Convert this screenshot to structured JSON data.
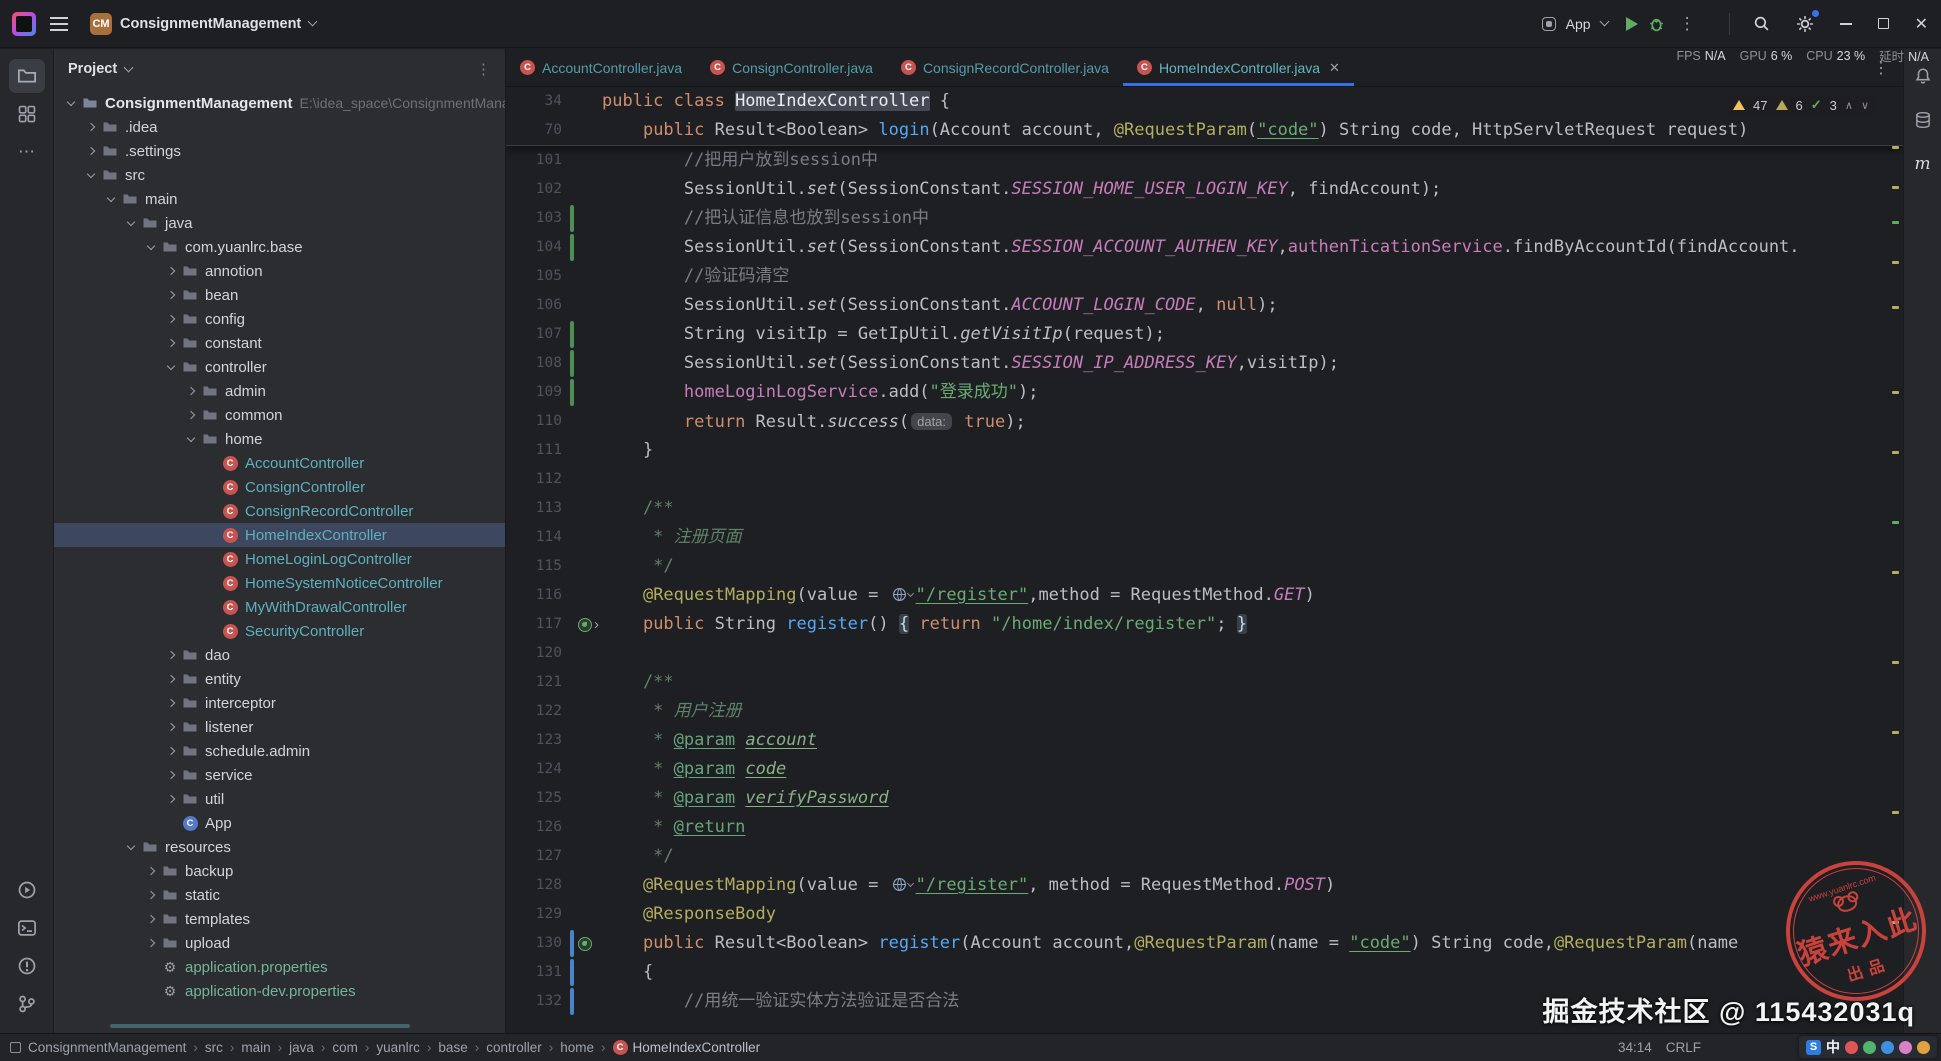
{
  "titlebar": {
    "project_badge": "CM",
    "project_name": "ConsignmentManagement",
    "run_config_label": "App",
    "perf": [
      [
        "FPS",
        "N/A"
      ],
      [
        "GPU",
        "6 %"
      ],
      [
        "CPU",
        "23 %"
      ],
      [
        "延时",
        "N/A"
      ]
    ]
  },
  "stripes": {
    "left_top": [
      "project",
      "structure",
      "more"
    ],
    "left_bottom": [
      "services",
      "terminal",
      "problems",
      "version-control"
    ],
    "right": [
      "notifications",
      "database",
      "maven"
    ]
  },
  "project_panel": {
    "title": "Project",
    "tree": [
      {
        "l": "ConsignmentManagement",
        "lv": 0,
        "ch": "o",
        "ic": "root",
        "bold": true,
        "ann": "E:\\idea_space\\ConsignmentManagem"
      },
      {
        "l": ".idea",
        "lv": 1,
        "ch": "c",
        "ic": "folder"
      },
      {
        "l": ".settings",
        "lv": 1,
        "ch": "c",
        "ic": "folder"
      },
      {
        "l": "src",
        "lv": 1,
        "ch": "o",
        "ic": "folder"
      },
      {
        "l": "main",
        "lv": 2,
        "ch": "o",
        "ic": "folder"
      },
      {
        "l": "java",
        "lv": 3,
        "ch": "o",
        "ic": "folder"
      },
      {
        "l": "com.yuanlrc.base",
        "lv": 4,
        "ch": "o",
        "ic": "folder"
      },
      {
        "l": "annotion",
        "lv": 5,
        "ch": "c",
        "ic": "folder"
      },
      {
        "l": "bean",
        "lv": 5,
        "ch": "c",
        "ic": "folder"
      },
      {
        "l": "config",
        "lv": 5,
        "ch": "c",
        "ic": "folder"
      },
      {
        "l": "constant",
        "lv": 5,
        "ch": "c",
        "ic": "folder"
      },
      {
        "l": "controller",
        "lv": 5,
        "ch": "o",
        "ic": "folder"
      },
      {
        "l": "admin",
        "lv": 6,
        "ch": "c",
        "ic": "folder"
      },
      {
        "l": "common",
        "lv": 6,
        "ch": "c",
        "ic": "folder"
      },
      {
        "l": "home",
        "lv": 6,
        "ch": "o",
        "ic": "folder"
      },
      {
        "l": "AccountController",
        "lv": 7,
        "ic": "class",
        "clr": "cyan"
      },
      {
        "l": "ConsignController",
        "lv": 7,
        "ic": "class",
        "clr": "cyan"
      },
      {
        "l": "ConsignRecordController",
        "lv": 7,
        "ic": "class",
        "clr": "cyan"
      },
      {
        "l": "HomeIndexController",
        "lv": 7,
        "ic": "class",
        "clr": "cyan",
        "sel": true
      },
      {
        "l": "HomeLoginLogController",
        "lv": 7,
        "ic": "class",
        "clr": "cyan"
      },
      {
        "l": "HomeSystemNoticeController",
        "lv": 7,
        "ic": "class",
        "clr": "cyan"
      },
      {
        "l": "MyWithDrawalController",
        "lv": 7,
        "ic": "class",
        "clr": "cyan"
      },
      {
        "l": "SecurityController",
        "lv": 7,
        "ic": "class",
        "clr": "cyan"
      },
      {
        "l": "dao",
        "lv": 5,
        "ch": "c",
        "ic": "folder"
      },
      {
        "l": "entity",
        "lv": 5,
        "ch": "c",
        "ic": "folder"
      },
      {
        "l": "interceptor",
        "lv": 5,
        "ch": "c",
        "ic": "folder"
      },
      {
        "l": "listener",
        "lv": 5,
        "ch": "c",
        "ic": "folder"
      },
      {
        "l": "schedule.admin",
        "lv": 5,
        "ch": "c",
        "ic": "folder"
      },
      {
        "l": "service",
        "lv": 5,
        "ch": "c",
        "ic": "folder"
      },
      {
        "l": "util",
        "lv": 5,
        "ch": "c",
        "ic": "folder"
      },
      {
        "l": "App",
        "lv": 5,
        "ic": "classb"
      },
      {
        "l": "resources",
        "lv": 3,
        "ch": "o",
        "ic": "folder"
      },
      {
        "l": "backup",
        "lv": 4,
        "ch": "c",
        "ic": "folder"
      },
      {
        "l": "static",
        "lv": 4,
        "ch": "c",
        "ic": "folder"
      },
      {
        "l": "templates",
        "lv": 4,
        "ch": "c",
        "ic": "folder"
      },
      {
        "l": "upload",
        "lv": 4,
        "ch": "c",
        "ic": "folder"
      },
      {
        "l": "application.properties",
        "lv": 4,
        "ic": "props",
        "clr": "green"
      },
      {
        "l": "application-dev.properties",
        "lv": 4,
        "ic": "props",
        "clr": "green"
      }
    ]
  },
  "tabs": [
    {
      "label": "AccountController.java",
      "active": false
    },
    {
      "label": "ConsignController.java",
      "active": false
    },
    {
      "label": "ConsignRecordController.java",
      "active": false
    },
    {
      "label": "HomeIndexController.java",
      "active": true
    }
  ],
  "editor": {
    "inspections": {
      "warnings": "47",
      "weak": "6",
      "passed": "3"
    },
    "sticky_lines": [
      {
        "n": "34",
        "segs": [
          [
            "public class ",
            "kw"
          ],
          [
            "HomeIndexController",
            "hl"
          ],
          [
            " {",
            "pln"
          ]
        ]
      },
      {
        "n": "70",
        "segs": [
          [
            "    ",
            "pln"
          ],
          [
            "public ",
            "kw"
          ],
          [
            "Result<Boolean> ",
            "pln"
          ],
          [
            "login",
            "mdecl"
          ],
          [
            "(Account account, ",
            "pln"
          ],
          [
            "@RequestParam",
            "ann"
          ],
          [
            "(",
            "pln"
          ],
          [
            "\"code\"",
            "strU"
          ],
          [
            ") String code, HttpServletRequest request)",
            "pln"
          ]
        ]
      }
    ],
    "lines": [
      {
        "n": "101",
        "segs": [
          [
            "        //把用户放到session中",
            "cmt"
          ]
        ]
      },
      {
        "n": "102",
        "segs": [
          [
            "        SessionUtil.",
            "pln"
          ],
          [
            "set",
            "sm"
          ],
          [
            "(SessionConstant.",
            "pln"
          ],
          [
            "SESSION_HOME_USER_LOGIN_KEY",
            "const"
          ],
          [
            ", findAccount);",
            "pln"
          ]
        ]
      },
      {
        "n": "103",
        "bar": "g",
        "segs": [
          [
            "        //把认证信息也放到session中",
            "cmt"
          ]
        ]
      },
      {
        "n": "104",
        "bar": "g",
        "segs": [
          [
            "        SessionUtil.",
            "pln"
          ],
          [
            "set",
            "sm"
          ],
          [
            "(SessionConstant.",
            "pln"
          ],
          [
            "SESSION_ACCOUNT_AUTHEN_KEY",
            "const"
          ],
          [
            ",",
            "pln"
          ],
          [
            "authenTicationService",
            "fld"
          ],
          [
            ".findByAccountId(findAccount.",
            "pln"
          ]
        ]
      },
      {
        "n": "105",
        "segs": [
          [
            "        //验证码清空",
            "cmt"
          ]
        ]
      },
      {
        "n": "106",
        "segs": [
          [
            "        SessionUtil.",
            "pln"
          ],
          [
            "set",
            "sm"
          ],
          [
            "(SessionConstant.",
            "pln"
          ],
          [
            "ACCOUNT_LOGIN_CODE",
            "const"
          ],
          [
            ", ",
            "pln"
          ],
          [
            "null",
            "kw"
          ],
          [
            ");",
            "pln"
          ]
        ]
      },
      {
        "n": "107",
        "bar": "g",
        "segs": [
          [
            "        String visitIp = GetIpUtil.",
            "pln"
          ],
          [
            "getVisitIp",
            "sm"
          ],
          [
            "(request);",
            "pln"
          ]
        ]
      },
      {
        "n": "108",
        "bar": "g",
        "segs": [
          [
            "        SessionUtil.",
            "pln"
          ],
          [
            "set",
            "sm"
          ],
          [
            "(SessionConstant.",
            "pln"
          ],
          [
            "SESSION_IP_ADDRESS_KEY",
            "const"
          ],
          [
            ",visitIp);",
            "pln"
          ]
        ]
      },
      {
        "n": "109",
        "bar": "g",
        "segs": [
          [
            "        ",
            "pln"
          ],
          [
            "homeLoginLogService",
            "fld"
          ],
          [
            ".add(",
            "pln"
          ],
          [
            "\"登录成功\"",
            "str"
          ],
          [
            ");",
            "pln"
          ]
        ]
      },
      {
        "n": "110",
        "segs": [
          [
            "        ",
            "pln"
          ],
          [
            "return",
            "kw"
          ],
          [
            " Result.",
            "pln"
          ],
          [
            "success",
            "sm"
          ],
          [
            "(",
            "pln"
          ],
          [
            "data:",
            "inlay"
          ],
          [
            " ",
            "pln"
          ],
          [
            "true",
            "kw"
          ],
          [
            ");",
            "pln"
          ]
        ]
      },
      {
        "n": "111",
        "segs": [
          [
            "    }",
            "pln"
          ]
        ]
      },
      {
        "n": "112",
        "segs": []
      },
      {
        "n": "113",
        "segs": [
          [
            "    /**",
            "doc"
          ]
        ]
      },
      {
        "n": "114",
        "segs": [
          [
            "     * ",
            "doc"
          ],
          [
            "注册页面",
            "docI"
          ]
        ]
      },
      {
        "n": "115",
        "segs": [
          [
            "     */",
            "doc"
          ]
        ]
      },
      {
        "n": "116",
        "segs": [
          [
            "    ",
            "pln"
          ],
          [
            "@RequestMapping",
            "ann"
          ],
          [
            "(value = ",
            "pln"
          ],
          [
            "",
            "globe"
          ],
          [
            "\"/register\"",
            "strU"
          ],
          [
            ",method = RequestMethod.",
            "pln"
          ],
          [
            "GET",
            "const"
          ],
          [
            ")",
            "pln"
          ]
        ]
      },
      {
        "n": "117",
        "gi": "spring-fold",
        "segs": [
          [
            "    ",
            "pln"
          ],
          [
            "public ",
            "kw"
          ],
          [
            "String ",
            "pln"
          ],
          [
            "register",
            "mdecl"
          ],
          [
            "() ",
            "pln"
          ],
          [
            "{",
            "fold"
          ],
          [
            " ",
            "pln"
          ],
          [
            "return",
            "kw"
          ],
          [
            " ",
            "pln"
          ],
          [
            "\"/home/index/register\"",
            "str"
          ],
          [
            "; ",
            "pln"
          ],
          [
            "}",
            "fold"
          ]
        ]
      },
      {
        "n": "120",
        "segs": []
      },
      {
        "n": "121",
        "segs": [
          [
            "    /**",
            "doc"
          ]
        ]
      },
      {
        "n": "122",
        "segs": [
          [
            "     * ",
            "doc"
          ],
          [
            "用户注册",
            "docI"
          ]
        ]
      },
      {
        "n": "123",
        "segs": [
          [
            "     * ",
            "doc"
          ],
          [
            "@param",
            "doctag"
          ],
          [
            " ",
            "doc"
          ],
          [
            "account",
            "docparam"
          ]
        ]
      },
      {
        "n": "124",
        "segs": [
          [
            "     * ",
            "doc"
          ],
          [
            "@param",
            "doctag"
          ],
          [
            " ",
            "doc"
          ],
          [
            "code",
            "docparam"
          ]
        ]
      },
      {
        "n": "125",
        "segs": [
          [
            "     * ",
            "doc"
          ],
          [
            "@param",
            "doctag"
          ],
          [
            " ",
            "doc"
          ],
          [
            "verifyPassword",
            "docparam"
          ]
        ]
      },
      {
        "n": "126",
        "segs": [
          [
            "     * ",
            "doc"
          ],
          [
            "@return",
            "doctag"
          ]
        ]
      },
      {
        "n": "127",
        "segs": [
          [
            "     */",
            "doc"
          ]
        ]
      },
      {
        "n": "128",
        "segs": [
          [
            "    ",
            "pln"
          ],
          [
            "@RequestMapping",
            "ann"
          ],
          [
            "(value = ",
            "pln"
          ],
          [
            "",
            "globe"
          ],
          [
            "\"/register\"",
            "strU"
          ],
          [
            ", method = RequestMethod.",
            "pln"
          ],
          [
            "POST",
            "const"
          ],
          [
            ")",
            "pln"
          ]
        ]
      },
      {
        "n": "129",
        "segs": [
          [
            "    ",
            "pln"
          ],
          [
            "@ResponseBody",
            "ann"
          ]
        ]
      },
      {
        "n": "130",
        "bar": "b",
        "gi": "spring",
        "segs": [
          [
            "    ",
            "pln"
          ],
          [
            "public ",
            "kw"
          ],
          [
            "Result<Boolean> ",
            "pln"
          ],
          [
            "register",
            "mdecl"
          ],
          [
            "(Account account,",
            "pln"
          ],
          [
            "@RequestParam",
            "ann"
          ],
          [
            "(name = ",
            "pln"
          ],
          [
            "\"code\"",
            "strU"
          ],
          [
            ") String code,",
            "pln"
          ],
          [
            "@RequestParam",
            "ann"
          ],
          [
            "(name",
            "pln"
          ]
        ]
      },
      {
        "n": "131",
        "bar": "b",
        "segs": [
          [
            "    {",
            "pln"
          ]
        ]
      },
      {
        "n": "132",
        "bar": "b",
        "segs": [
          [
            "        //用统一验证实体方法验证是否合法",
            "cmt"
          ]
        ]
      }
    ]
  },
  "statusbar": {
    "nav": [
      "ConsignmentManagement",
      "src",
      "main",
      "java",
      "com",
      "yuanlrc",
      "base",
      "controller",
      "home"
    ],
    "nav_class": "HomeIndexController",
    "caret": "34:14",
    "encoding_hint": "CRLF"
  },
  "overlays": {
    "stamp_main": "猿来入此",
    "stamp_sub": "出品",
    "stamp_site": "www.yuanlrc.com",
    "credit": "掘金技术社区 @ 115432031q",
    "ime": "中",
    "ime_logo": "S"
  },
  "colors": {
    "accent": "#3574f0",
    "selection": "#3e4760",
    "class_icon": "#c75450",
    "file_cyan": "#5fb0bd",
    "file_green": "#74b49a",
    "warning": "#f2c55c",
    "ok": "#5fad65",
    "stamp_red": "#d8453e"
  }
}
